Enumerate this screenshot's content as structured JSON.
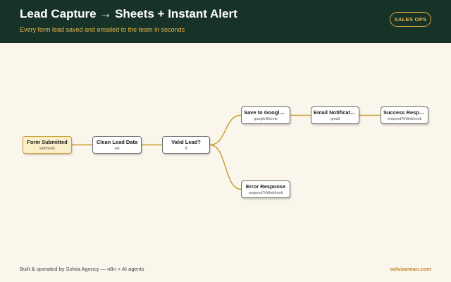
{
  "header": {
    "title": "Lead Capture → Sheets + Instant Alert",
    "subtitle": "Every form lead saved and emailed to the team in seconds",
    "badge": "SALES OPS"
  },
  "nodes": [
    {
      "id": "form-submitted",
      "name": "Form Submitted",
      "type": "webhook"
    },
    {
      "id": "clean-lead-data",
      "name": "Clean Lead Data",
      "type": "set"
    },
    {
      "id": "valid-lead",
      "name": "Valid Lead?",
      "type": "if"
    },
    {
      "id": "save-to-sheets",
      "name": "Save to Google Sheets",
      "type": "googleSheets"
    },
    {
      "id": "email-notification",
      "name": "Email Notification",
      "type": "gmail"
    },
    {
      "id": "success-response",
      "name": "Success Response",
      "type": "respondToWebhook"
    },
    {
      "id": "error-response",
      "name": "Error Response",
      "type": "respondToWebhook"
    }
  ],
  "edges": [
    [
      "form-submitted",
      "clean-lead-data"
    ],
    [
      "clean-lead-data",
      "valid-lead"
    ],
    [
      "valid-lead",
      "save-to-sheets"
    ],
    [
      "valid-lead",
      "error-response"
    ],
    [
      "save-to-sheets",
      "email-notification"
    ],
    [
      "email-notification",
      "success-response"
    ]
  ],
  "footer": {
    "left": "Built & operated by Solvia Agency — n8n + AI agents",
    "right": "solviaoman.com"
  },
  "colors": {
    "header_bg": "#173328",
    "accent": "#e6b54a",
    "edge": "#c99a2c",
    "canvas_bg": "#faf6ec"
  }
}
